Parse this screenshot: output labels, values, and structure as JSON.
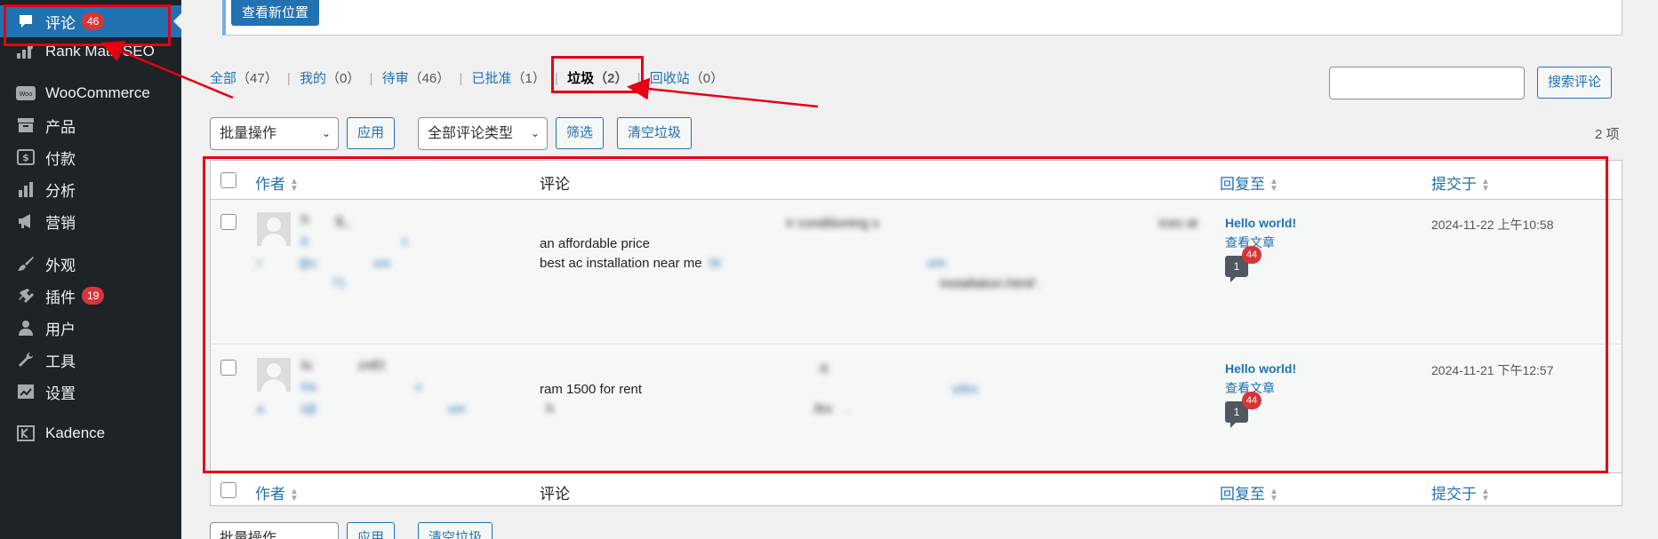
{
  "sidebar": {
    "items": [
      {
        "label": "评论",
        "badge": "46",
        "icon": "comment-icon",
        "active": true
      },
      {
        "label": "Rank Math SEO",
        "icon": "rank-math-icon"
      },
      {
        "label": "WooCommerce",
        "icon": "woocommerce-icon"
      },
      {
        "label": "产品",
        "icon": "archive-icon"
      },
      {
        "label": "付款",
        "icon": "money-icon"
      },
      {
        "label": "分析",
        "icon": "chart-bar-icon"
      },
      {
        "label": "营销",
        "icon": "megaphone-icon"
      },
      {
        "label": "外观",
        "icon": "brush-icon"
      },
      {
        "label": "插件",
        "badge": "19",
        "icon": "plugin-icon"
      },
      {
        "label": "用户",
        "icon": "user-icon"
      },
      {
        "label": "工具",
        "icon": "wrench-icon"
      },
      {
        "label": "设置",
        "icon": "settings-icon"
      },
      {
        "label": "Kadence",
        "icon": "kadence-icon"
      }
    ]
  },
  "top": {
    "view_location_label": "查看新位置"
  },
  "filters": [
    {
      "label": "全部",
      "count": "（47）"
    },
    {
      "label": "我的",
      "count": "（0）"
    },
    {
      "label": "待审",
      "count": "（46）"
    },
    {
      "label": "已批准",
      "count": "（1）"
    },
    {
      "label": "垃圾",
      "count": "（2）",
      "current": true
    },
    {
      "label": "回收站",
      "count": "（0）"
    }
  ],
  "search": {
    "button_label": "搜索评论",
    "placeholder": ""
  },
  "toolbar": {
    "bulk_label": "批量操作",
    "apply_label": "应用",
    "type_label": "全部评论类型",
    "filter_label": "筛选",
    "empty_spam_label": "清空垃圾",
    "items_count": "2 项"
  },
  "columns": {
    "author": "作者",
    "comment": "评论",
    "response": "回复至",
    "submitted": "提交于"
  },
  "comments": [
    {
      "author": "h    g_",
      "author_link": "b               x",
      "email": "r      @c         om",
      "ip": "            71",
      "lines": [
        "                                     ir conditioning s                                          ices at",
        "an affordable price",
        "best ac installation near me",
        "                                                            installation.html/ ."
      ],
      "line3_link": "ht                               om",
      "post": "Hello world!",
      "view_post": "查看文章",
      "count": "1",
      "pending": "44",
      "date": "2024-11-22 上午10:58"
    },
    {
      "author": "lu       zxEt",
      "author_link": "tra                x",
      "email": "a      t@                     om",
      "ip": "             ",
      "lines": [
        "                                          rt",
        "ram 1500 for rent",
        " h                                       /trx  ."
      ],
      "line2_link": "                                              s/trx",
      "post": "Hello world!",
      "view_post": "查看文章",
      "count": "1",
      "pending": "44",
      "date": "2024-11-21 下午12:57"
    }
  ],
  "bottom_toolbar": {
    "bulk_label": "批量操作",
    "apply_label": "应用",
    "empty_spam_label": "清空垃圾"
  },
  "colors": {
    "sidebar_bg": "#1d2327",
    "active": "#2271b1",
    "annotation": "#e60012",
    "badge": "#d63638"
  }
}
